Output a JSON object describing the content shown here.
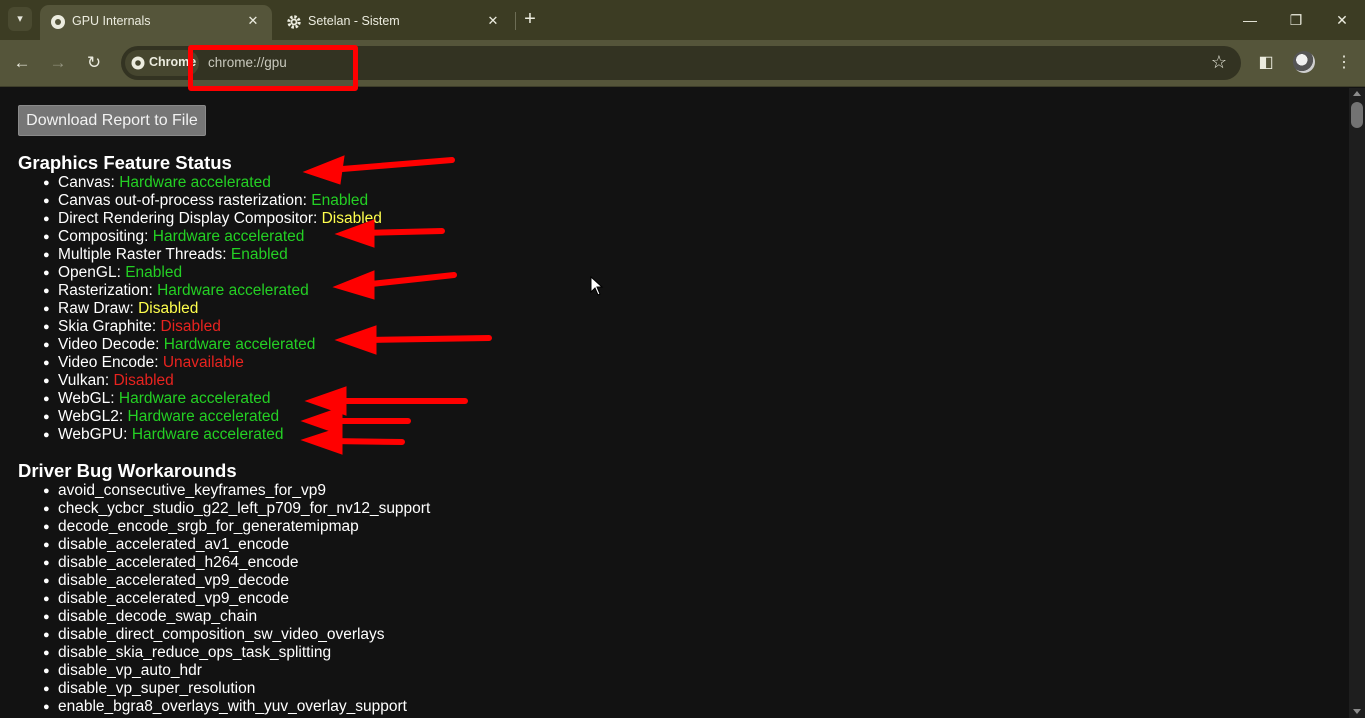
{
  "browser": {
    "tabs": [
      {
        "title": "GPU Internals",
        "active": true,
        "icon": "chrome-page-icon"
      },
      {
        "title": "Setelan - Sistem",
        "active": false,
        "icon": "gear-icon"
      }
    ],
    "tab_search_icon": "chevron-down-icon",
    "new_tab_symbol": "+",
    "close_symbol": "✕",
    "window_controls": {
      "minimize": "—",
      "restore": "❐",
      "close": "✕"
    },
    "omnibox": {
      "chip_label": "Chrome",
      "url": "chrome://gpu"
    }
  },
  "page": {
    "download_button": "Download Report to File",
    "feature_status": {
      "title": "Graphics Feature Status",
      "items": [
        {
          "name": "Canvas:",
          "status": "Hardware accelerated",
          "color": "#24d024"
        },
        {
          "name": "Canvas out-of-process rasterization:",
          "status": "Enabled",
          "color": "#24d024"
        },
        {
          "name": "Direct Rendering Display Compositor:",
          "status": "Disabled",
          "color": "#ffff4d"
        },
        {
          "name": "Compositing:",
          "status": "Hardware accelerated",
          "color": "#24d024"
        },
        {
          "name": "Multiple Raster Threads:",
          "status": "Enabled",
          "color": "#24d024"
        },
        {
          "name": "OpenGL:",
          "status": "Enabled",
          "color": "#24d024"
        },
        {
          "name": "Rasterization:",
          "status": "Hardware accelerated",
          "color": "#24d024"
        },
        {
          "name": "Raw Draw:",
          "status": "Disabled",
          "color": "#ffff4d"
        },
        {
          "name": "Skia Graphite:",
          "status": "Disabled",
          "color": "#e8231f"
        },
        {
          "name": "Video Decode:",
          "status": "Hardware accelerated",
          "color": "#24d024"
        },
        {
          "name": "Video Encode:",
          "status": "Unavailable",
          "color": "#e8231f"
        },
        {
          "name": "Vulkan:",
          "status": "Disabled",
          "color": "#e8231f"
        },
        {
          "name": "WebGL:",
          "status": "Hardware accelerated",
          "color": "#24d024"
        },
        {
          "name": "WebGL2:",
          "status": "Hardware accelerated",
          "color": "#24d024"
        },
        {
          "name": "WebGPU:",
          "status": "Hardware accelerated",
          "color": "#24d024"
        }
      ]
    },
    "workarounds": {
      "title": "Driver Bug Workarounds",
      "items": [
        "avoid_consecutive_keyframes_for_vp9",
        "check_ycbcr_studio_g22_left_p709_for_nv12_support",
        "decode_encode_srgb_for_generatemipmap",
        "disable_accelerated_av1_encode",
        "disable_accelerated_h264_encode",
        "disable_accelerated_vp9_decode",
        "disable_accelerated_vp9_encode",
        "disable_decode_swap_chain",
        "disable_direct_composition_sw_video_overlays",
        "disable_skia_reduce_ops_task_splitting",
        "disable_vp_auto_hdr",
        "disable_vp_super_resolution",
        "enable_bgra8_overlays_with_yuv_overlay_support"
      ]
    }
  },
  "annotation_color": "#ff0000"
}
